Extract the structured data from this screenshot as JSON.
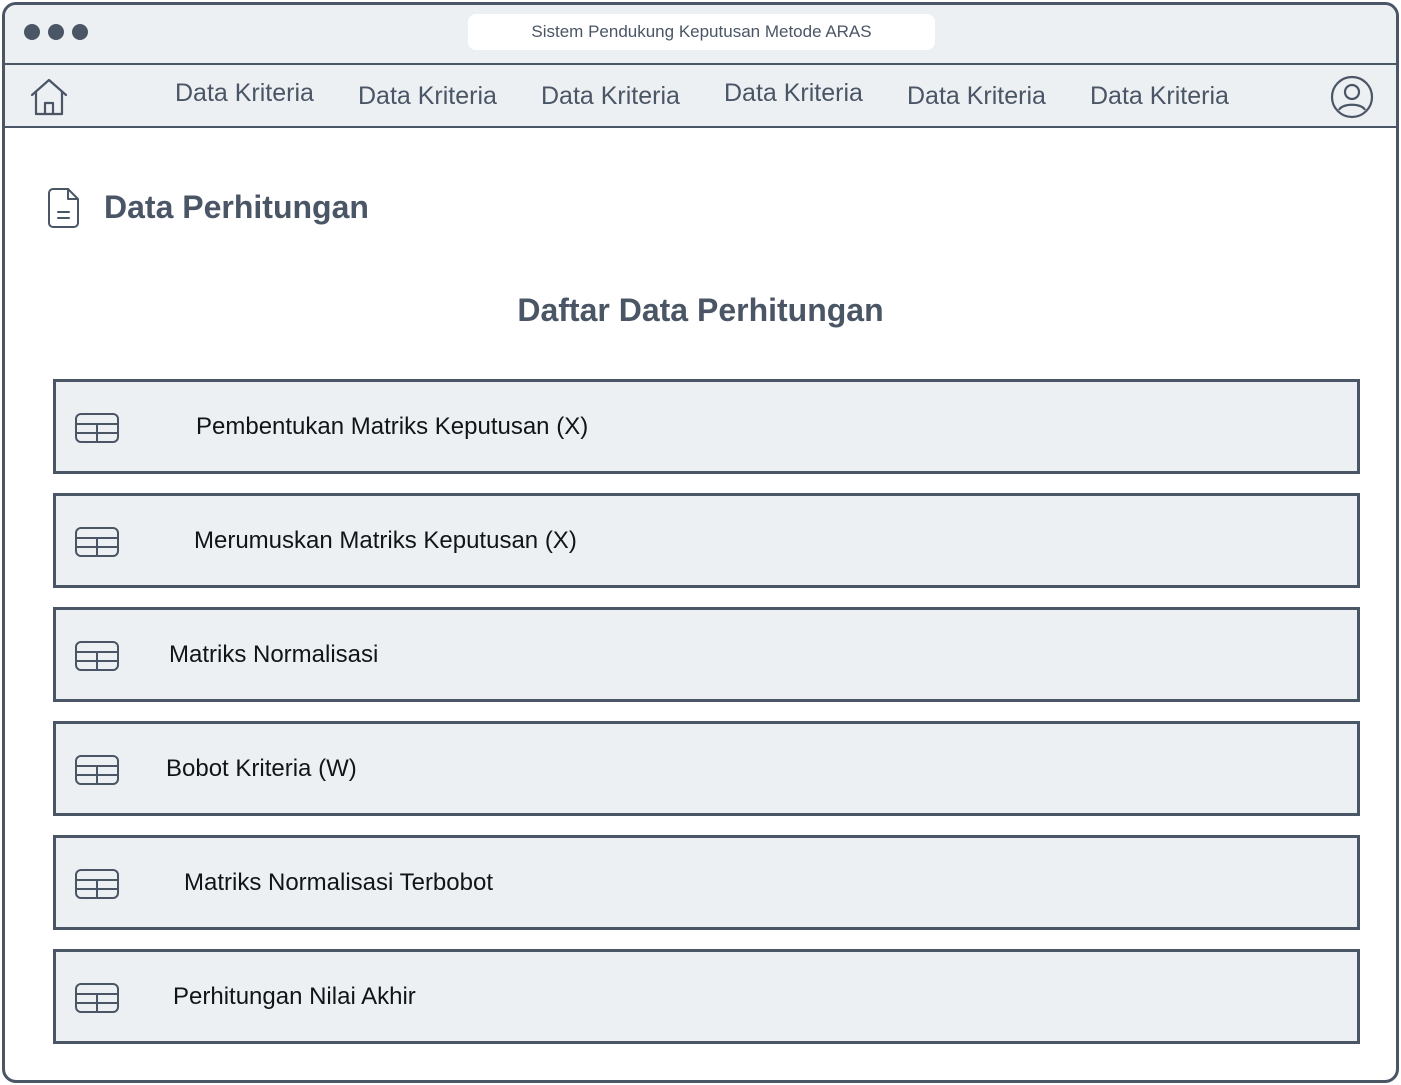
{
  "window": {
    "address_bar": "Sistem Pendukung Keputusan Metode ARAS"
  },
  "navbar": {
    "home_icon": "home-icon",
    "user_icon": "user-circle-icon",
    "items": [
      {
        "label": "Data Kriteria"
      },
      {
        "label": "Data Kriteria"
      },
      {
        "label": "Data Kriteria"
      },
      {
        "label": "Data Kriteria"
      },
      {
        "label": "Data Kriteria"
      },
      {
        "label": "Data Kriteria"
      }
    ]
  },
  "page": {
    "icon": "document-icon",
    "title": "Data Perhitungan",
    "section_title": "Daftar Data Perhitungan"
  },
  "list": {
    "item_icon": "table-icon",
    "items": [
      {
        "label": "Pembentukan Matriks Keputusan (X)"
      },
      {
        "label": "Merumuskan Matriks Keputusan (X)"
      },
      {
        "label": "Matriks Normalisasi"
      },
      {
        "label": "Bobot Kriteria (W)"
      },
      {
        "label": "Matriks Normalisasi Terbobot"
      },
      {
        "label": "Perhitungan Nilai Akhir"
      }
    ]
  },
  "colors": {
    "primary": "#4a5565",
    "panel": "#edf0f3",
    "text_dark": "#111418"
  }
}
